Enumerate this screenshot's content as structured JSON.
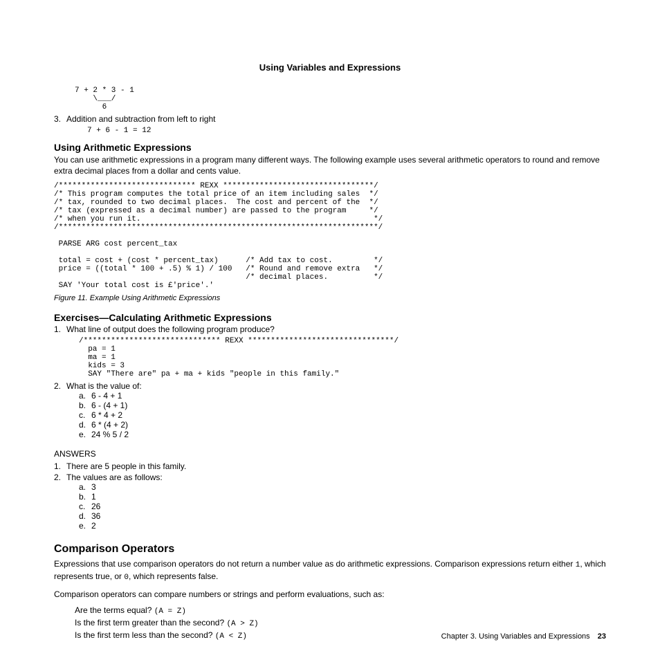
{
  "running_head": "Using Variables and Expressions",
  "pre1": "7 + 2 * 3 - 1\n    \\___/\n      6",
  "step3_text": "Addition and subtraction from left to right",
  "pre2": "7 + 6 - 1 = 12",
  "s1_heading": "Using Arithmetic Expressions",
  "s1_para": "You can use arithmetic expressions in a program many different ways. The following example uses several arithmetic operators to round and remove extra decimal places from a dollar and cents value.",
  "code1": "/****************************** REXX *********************************/\n/* This program computes the total price of an item including sales  */\n/* tax, rounded to two decimal places.  The cost and percent of the  */\n/* tax (expressed as a decimal number) are passed to the program     */\n/* when you run it.                                                   */\n/**********************************************************************/\n\n PARSE ARG cost percent_tax\n\n total = cost + (cost * percent_tax)      /* Add tax to cost.         */\n price = ((total * 100 + .5) % 1) / 100   /* Round and remove extra   */\n                                          /* decimal places.          */\n SAY 'Your total cost is £'price'.'",
  "fig_caption": "Figure 11. Example Using Arithmetic Expressions",
  "s2_heading": "Exercises—Calculating Arithmetic Expressions",
  "q1_text": "What line of output does the following program produce?",
  "code2": "/****************************** REXX ********************************/\n  pa = 1\n  ma = 1\n  kids = 3\n  SAY \"There are\" pa + ma + kids \"people in this family.\"",
  "q2_text": "What is the value of:",
  "q2a": "6 - 4 + 1",
  "q2b": "6 - (4 + 1)",
  "q2c": "6 * 4 + 2",
  "q2d": "6 * (4 + 2)",
  "q2e": "24 % 5 / 2",
  "answers_label": "ANSWERS",
  "a1": "There are 5 people in this family.",
  "a2_intro": "The values are as follows:",
  "a2a": "3",
  "a2b": "1",
  "a2c": "26",
  "a2d": "36",
  "a2e": "2",
  "s3_heading": "Comparison Operators",
  "s3_para1a": "Expressions that use comparison operators do not return a number value as do arithmetic expressions. Comparison expressions return either ",
  "s3_para1_code1": "1",
  "s3_para1b": ", which represents true, or ",
  "s3_para1_code2": "0",
  "s3_para1c": ", which represents false.",
  "s3_para2": "Comparison operators can compare numbers or strings and perform evaluations, such as:",
  "cmp1a": "Are the terms equal? ",
  "cmp1b": "(A = Z)",
  "cmp2a": "Is the first term greater than the second? ",
  "cmp2b": "(A > Z)",
  "cmp3a": "Is the first term less than the second? ",
  "cmp3b": "(A < Z)",
  "footer_chapter": "Chapter 3. Using Variables and Expressions",
  "footer_page": "23"
}
